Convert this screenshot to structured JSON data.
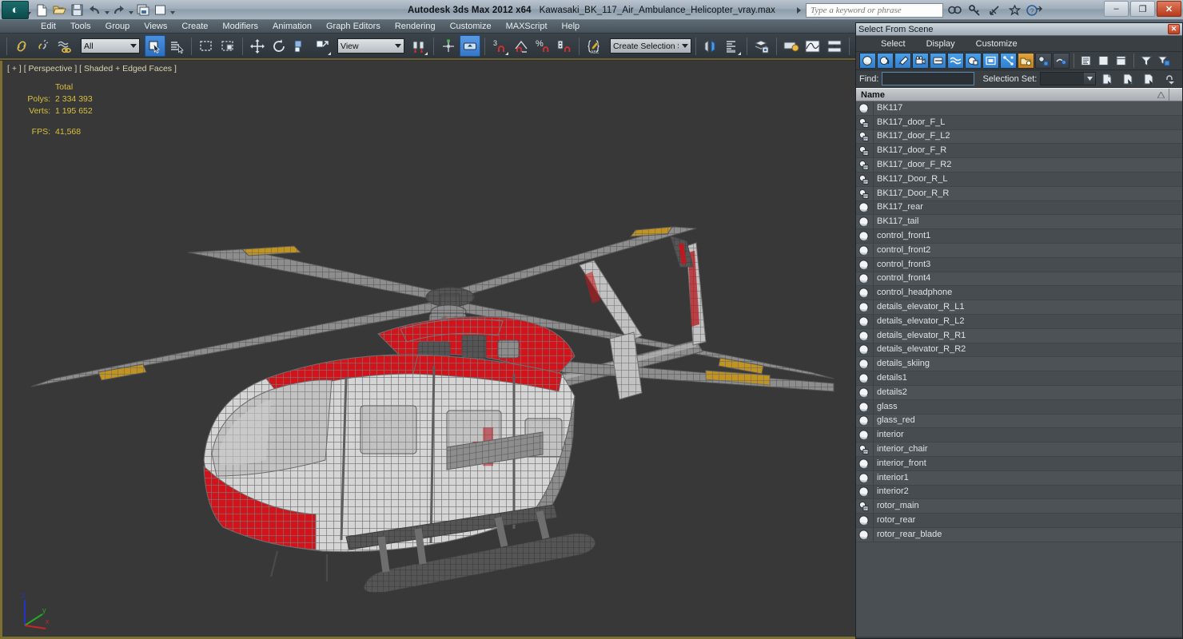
{
  "titlebar": {
    "app_title": "Autodesk 3ds Max  2012 x64",
    "file_name": "Kawasaki_BK_117_Air_Ambulance_Helicopter_vray.max",
    "logo": "3ds-max-logo",
    "quick_access": [
      {
        "name": "new-file-icon",
        "label": "New"
      },
      {
        "name": "open-file-icon",
        "label": "Open"
      },
      {
        "name": "save-file-icon",
        "label": "Save"
      },
      {
        "name": "undo-icon",
        "label": "Undo"
      },
      {
        "name": "redo-icon",
        "label": "Redo"
      },
      {
        "name": "set-project-folder-icon",
        "label": "Set Project Folder"
      },
      {
        "name": "render-frame-icon",
        "label": "Render"
      },
      {
        "name": "customize-qat-icon",
        "label": "Customize Quick Access Toolbar"
      }
    ],
    "search": {
      "placeholder": "Type a keyword or phrase",
      "value": ""
    },
    "help_icons": [
      {
        "name": "search-help-icon",
        "label": "Search"
      },
      {
        "name": "key-help-icon",
        "label": "Key"
      },
      {
        "name": "satellite-help-icon",
        "label": "Communication Center"
      },
      {
        "name": "favorites-star-icon",
        "label": "Favorites"
      },
      {
        "name": "help-arrow-icon",
        "label": "Help"
      }
    ],
    "window_buttons": [
      {
        "name": "minimize-button",
        "glyph": "–"
      },
      {
        "name": "restore-button",
        "glyph": "❐"
      },
      {
        "name": "close-button",
        "glyph": "✕"
      }
    ]
  },
  "menubar": {
    "items": [
      "Edit",
      "Tools",
      "Group",
      "Views",
      "Create",
      "Modifiers",
      "Animation",
      "Graph Editors",
      "Rendering",
      "Customize",
      "MAXScript",
      "Help"
    ]
  },
  "toolbar": {
    "selection_filter": {
      "value": "All",
      "name": "selection-filter-combo"
    },
    "reference_coord": {
      "value": "View",
      "name": "reference-coordinate-system-combo"
    },
    "named_selection_set": {
      "value": "Create Selection Se",
      "placeholder": "Create Selection Set",
      "name": "named-selection-set-combo"
    },
    "buttons": [
      {
        "name": "select-and-link-icon",
        "label": "Select and Link"
      },
      {
        "name": "unlink-selection-icon",
        "label": "Unlink Selection"
      },
      {
        "name": "bind-to-space-warp-icon",
        "label": "Bind to Space Warp"
      },
      {
        "name": "select-object-icon",
        "label": "Select Object",
        "active": true
      },
      {
        "name": "select-by-name-icon",
        "label": "Select by Name"
      },
      {
        "name": "rectangular-selection-region-icon",
        "label": "Rectangular Selection Region"
      },
      {
        "name": "window-crossing-icon",
        "label": "Window / Crossing"
      },
      {
        "name": "select-and-move-icon",
        "label": "Select and Move"
      },
      {
        "name": "select-and-rotate-icon",
        "label": "Select and Rotate"
      },
      {
        "name": "select-and-scale-icon",
        "label": "Select and Uniform Scale"
      },
      {
        "name": "use-center-flyout-icon",
        "label": "Use Pivot Point Center"
      },
      {
        "name": "select-and-manipulate-icon",
        "label": "Select and Manipulate"
      },
      {
        "name": "snaps-toggle-icon",
        "label": "3D Snaps Toggle",
        "badge": "3"
      },
      {
        "name": "angle-snap-toggle-icon",
        "label": "Angle Snap Toggle"
      },
      {
        "name": "percent-snap-toggle-icon",
        "label": "Percent Snap Toggle"
      },
      {
        "name": "spinner-snap-toggle-icon",
        "label": "Spinner Snap Toggle"
      },
      {
        "name": "edit-named-selection-sets-icon",
        "label": "Edit Named Selection Sets"
      },
      {
        "name": "mirror-icon",
        "label": "Mirror"
      },
      {
        "name": "align-icon",
        "label": "Align"
      },
      {
        "name": "layer-manager-icon",
        "label": "Layer Manager"
      },
      {
        "name": "toggle-ribbon-icon",
        "label": "Toggle Ribbon"
      },
      {
        "name": "curve-editor-icon",
        "label": "Curve Editor"
      },
      {
        "name": "schematic-view-icon",
        "label": "Schematic View"
      },
      {
        "name": "material-editor-icon",
        "label": "Material Editor"
      },
      {
        "name": "render-setup-icon",
        "label": "Render Setup"
      },
      {
        "name": "rendered-frame-window-icon",
        "label": "Rendered Frame Window"
      },
      {
        "name": "render-production-icon",
        "label": "Render Production"
      }
    ]
  },
  "viewport": {
    "label": "[ + ] [ Perspective ] [ Shaded + Edged Faces ]",
    "stats": {
      "header": "Total",
      "rows": [
        {
          "label": "Polys:",
          "value": "2 334 393"
        },
        {
          "label": "Verts:",
          "value": "1 195 652"
        }
      ],
      "fps_label": "FPS:",
      "fps_value": "41,568"
    },
    "axis": {
      "x": "x",
      "y": "y",
      "z": "z",
      "x_color": "#cc2222",
      "y_color": "#22aa22",
      "z_color": "#2233cc"
    },
    "model": {
      "name": "Kawasaki BK 117 Air Ambulance Helicopter",
      "body_color": "#d8d8d8",
      "accent_color": "#d41017",
      "wire_color": "#6e6e6e",
      "rotor_tip_color": "#c89a20",
      "background_color": "#383838"
    }
  },
  "dialog": {
    "title": "Select From Scene",
    "close_glyph": "✕",
    "menu": [
      "Select",
      "Display",
      "Customize"
    ],
    "tool_buttons": [
      {
        "name": "display-geometry-icon",
        "label": "Display Geometry",
        "style": "blue"
      },
      {
        "name": "display-shapes-icon",
        "label": "Display Shapes",
        "style": "blue"
      },
      {
        "name": "display-lights-icon",
        "label": "Display Lights",
        "style": "blue"
      },
      {
        "name": "display-cameras-icon",
        "label": "Display Cameras",
        "style": "blue"
      },
      {
        "name": "display-helpers-icon",
        "label": "Display Helpers",
        "style": "blue"
      },
      {
        "name": "display-space-warps-icon",
        "label": "Display Space Warps",
        "style": "blue"
      },
      {
        "name": "display-groups-icon",
        "label": "Display Groups/Assemblies",
        "style": "blue"
      },
      {
        "name": "display-xrefs-icon",
        "label": "Display XRefs",
        "style": "blue"
      },
      {
        "name": "display-bone-objects-icon",
        "label": "Display Bone Objects",
        "style": "blue"
      },
      {
        "name": "display-containers-icon",
        "label": "Display Containers",
        "style": "yellow"
      },
      {
        "name": "display-children-icon",
        "label": "Display Children",
        "style": "gray"
      },
      {
        "name": "display-influences-icon",
        "label": "Display Influences",
        "style": "gray"
      },
      {
        "name": "list-types-icon",
        "label": "List Types",
        "style": "plain"
      },
      {
        "name": "expand-all-icon",
        "label": "Expand All",
        "style": "plain"
      },
      {
        "name": "collapse-all-icon",
        "label": "Collapse All",
        "style": "plain"
      },
      {
        "name": "filter-funnel-icon",
        "label": "Selection Filter",
        "style": "plain"
      },
      {
        "name": "configure-filter-icon",
        "label": "Configure Filter",
        "style": "plain"
      }
    ],
    "find": {
      "label": "Find:",
      "value": "",
      "name": "find-input"
    },
    "selection_set": {
      "label": "Selection Set:",
      "value": "",
      "name": "selection-set-combo"
    },
    "set_buttons": [
      {
        "name": "create-new-set-icon",
        "label": "Create New Set"
      },
      {
        "name": "select-set-icon",
        "label": "Select Objects in Set"
      },
      {
        "name": "remove-set-icon",
        "label": "Remove Set"
      },
      {
        "name": "sort-options-icon",
        "label": "Sort Options"
      }
    ],
    "column_header": {
      "name_label": "Name",
      "sort_glyph": "△"
    },
    "objects": [
      {
        "name": "BK117",
        "icon": "geometry-sphere-icon"
      },
      {
        "name": "BK117_door_F_L",
        "icon": "editable-poly-icon"
      },
      {
        "name": "BK117_door_F_L2",
        "icon": "editable-poly-icon"
      },
      {
        "name": "BK117_door_F_R",
        "icon": "editable-poly-icon"
      },
      {
        "name": "BK117_door_F_R2",
        "icon": "editable-poly-icon"
      },
      {
        "name": "BK117_Door_R_L",
        "icon": "editable-poly-icon"
      },
      {
        "name": "BK117_Door_R_R",
        "icon": "editable-poly-icon"
      },
      {
        "name": "BK117_rear",
        "icon": "geometry-sphere-icon"
      },
      {
        "name": "BK117_tail",
        "icon": "geometry-sphere-icon"
      },
      {
        "name": "control_front1",
        "icon": "geometry-sphere-icon"
      },
      {
        "name": "control_front2",
        "icon": "geometry-sphere-icon"
      },
      {
        "name": "control_front3",
        "icon": "geometry-sphere-icon"
      },
      {
        "name": "control_front4",
        "icon": "geometry-sphere-icon"
      },
      {
        "name": "control_headphone",
        "icon": "geometry-sphere-icon"
      },
      {
        "name": "details_elevator_R_L1",
        "icon": "geometry-sphere-icon"
      },
      {
        "name": "details_elevator_R_L2",
        "icon": "geometry-sphere-icon"
      },
      {
        "name": "details_elevator_R_R1",
        "icon": "geometry-sphere-icon"
      },
      {
        "name": "details_elevator_R_R2",
        "icon": "geometry-sphere-icon"
      },
      {
        "name": "details_skiing",
        "icon": "geometry-sphere-icon"
      },
      {
        "name": "details1",
        "icon": "geometry-sphere-icon"
      },
      {
        "name": "details2",
        "icon": "geometry-sphere-icon"
      },
      {
        "name": "glass",
        "icon": "geometry-sphere-icon"
      },
      {
        "name": "glass_red",
        "icon": "geometry-sphere-icon"
      },
      {
        "name": "interior",
        "icon": "geometry-sphere-icon"
      },
      {
        "name": "interior_chair",
        "icon": "editable-poly-icon"
      },
      {
        "name": "interior_front",
        "icon": "geometry-sphere-icon"
      },
      {
        "name": "interior1",
        "icon": "geometry-sphere-icon"
      },
      {
        "name": "interior2",
        "icon": "geometry-sphere-icon"
      },
      {
        "name": "rotor_main",
        "icon": "editable-poly-icon"
      },
      {
        "name": "rotor_rear",
        "icon": "geometry-sphere-icon"
      },
      {
        "name": "rotor_rear_blade",
        "icon": "geometry-sphere-icon"
      }
    ]
  }
}
